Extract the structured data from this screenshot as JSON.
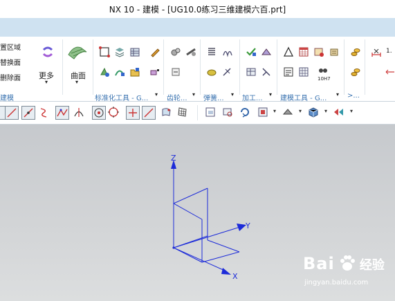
{
  "window": {
    "title": "NX 10 - 建模 - [UG10.0练习三维建模六百.prt]"
  },
  "ribbon": {
    "left_items": [
      "置区域",
      "替换面",
      "删除面"
    ],
    "more_label": "更多",
    "surface_label": "曲面",
    "sync_group": "建模",
    "groups": {
      "std_tools": "标准化工具 - G...",
      "gear": "齿轮...",
      "spring": "弹簧...",
      "machining": "加工...",
      "model_tools": "建模工具 - G...",
      "extra": ">..."
    },
    "misc_label": "1.",
    "hole_label": "10H7"
  },
  "viewport": {
    "axis_x": "X",
    "axis_y": "Y",
    "axis_z": "Z",
    "axis_color": "#1c2bd9"
  },
  "watermark": {
    "brand": "Bai",
    "brand_suffix": "经验",
    "url": "jingyan.baidu.com"
  }
}
